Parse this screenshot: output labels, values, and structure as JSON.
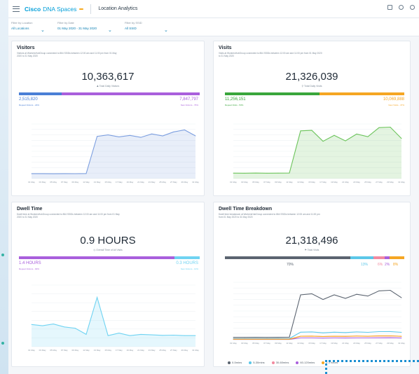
{
  "app": {
    "brand_primary": "Cisco",
    "brand_secondary": "DNA Spaces",
    "beta_badge": "",
    "page_title": "Location Analytics",
    "accent": "#049fd9"
  },
  "filters": [
    {
      "label": "Filter by Location",
      "value": "All Locations"
    },
    {
      "label": "Filter by Date",
      "value": "01 May 2020 - 31 May 2020"
    },
    {
      "label": "Filter by SSID",
      "value": "All SSID"
    }
  ],
  "visitors": {
    "title": "Visitors",
    "description": "Visitors at WorkersHubGroup connected to 864 SSIDs between 12:00 am and 11:00 pm from 01 May 2020 to 31 May 2020",
    "total": "10,363,617",
    "total_label": "Total Daily Visitors",
    "left_value": "2,515,820",
    "left_label": "Repeat Visitors - 24%",
    "right_value": "7,847,797",
    "right_label": "New Visitors - 76%",
    "left_color": "#4a7fd6",
    "right_color": "#a95fdc"
  },
  "visits": {
    "title": "Visits",
    "description": "Visits at WorkersHubGroup connected to 864 SSIDs between 12:00 am and 11:00 pm from 01 May 2020 to 31 May 2020",
    "total": "21,326,039",
    "total_label": "Total Daily Visits",
    "left_value": "11,256,151",
    "left_label": "Repeat Visits - 53%",
    "right_value": "10,069,888",
    "right_label": "New Visits - 47%",
    "left_color": "#3aa63c",
    "right_color": "#f5a623"
  },
  "dwell": {
    "title": "Dwell Time",
    "description": "Dwell time at WorkersHubGroup connected to 864 SSIDs between 12:00 am and 11:00 pm from 01 May 2020 to 31 May 2020",
    "total": "0.9 HOURS",
    "total_label": "Overall Time of All Visits",
    "left_value": "1.4 HOURS",
    "left_label": "Repeat Visitors - 90%",
    "right_value": "0.3 HOURS",
    "right_label": "New Visitors - 10%",
    "left_color": "#a95fdc",
    "right_color": "#6fd3f2"
  },
  "breakdown": {
    "title": "Dwell Time Breakdown",
    "description": "Dwell time breakdown at WorkersHubGroup connected to 864 SSIDs between 12:00 am and 11:00 pm from 01 May 2020 to 31 May 2020",
    "total": "21,318,496",
    "total_label": "Total Visits",
    "segments": [
      {
        "pct": "70%",
        "value": 70,
        "color": "#5b6470"
      },
      {
        "pct": "13%",
        "value": 13,
        "color": "#5bc7e8"
      },
      {
        "pct": "6%",
        "value": 6,
        "color": "#f28aa0"
      },
      {
        "pct": "2%",
        "value": 3,
        "color": "#a95fdc"
      },
      {
        "pct": "8%",
        "value": 8,
        "color": "#f5a623"
      }
    ],
    "legend": [
      "0-5mins",
      "5-30mins",
      "30-60mins",
      "60-120mins",
      "> 2 hours"
    ]
  },
  "chart_data": [
    {
      "type": "area",
      "title": "",
      "xlabel": "",
      "ylabel": "",
      "ylim": [
        0,
        1100000
      ],
      "x": [
        "01 May",
        "03 May",
        "05 May",
        "07 May",
        "09 May",
        "11 May",
        "13 May",
        "15 May",
        "17 May",
        "19 May",
        "21 May",
        "23 May",
        "25 May",
        "27 May",
        "29 May",
        "31 May"
      ],
      "series": [
        {
          "values": [
            100000,
            100000,
            98000,
            100000,
            99000,
            101000,
            850000,
            880000,
            840000,
            870000,
            830000,
            900000,
            860000,
            940000,
            980000,
            860000
          ]
        }
      ],
      "yticks": [
        "",
        "",
        "",
        "",
        "",
        "",
        "",
        "",
        "",
        "",
        ""
      ],
      "color": "#7d9fe0"
    },
    {
      "type": "area",
      "title": "",
      "xlabel": "",
      "ylabel": "",
      "ylim": [
        0,
        1200000
      ],
      "x": [
        "01 May",
        "03 May",
        "05 May",
        "07 May",
        "09 May",
        "11 May",
        "13 May",
        "15 May",
        "17 May",
        "19 May",
        "21 May",
        "23 May",
        "25 May",
        "27 May",
        "29 May",
        "31 May"
      ],
      "series": [
        {
          "values": [
            120000,
            118000,
            121000,
            119000,
            120000,
            122000,
            1050000,
            1060000,
            820000,
            950000,
            830000,
            980000,
            920000,
            1120000,
            1130000,
            880000
          ]
        }
      ],
      "yticks": [
        "",
        "",
        "",
        "",
        "",
        "",
        "",
        "",
        "",
        "",
        ""
      ],
      "color": "#6cc45b"
    },
    {
      "type": "area",
      "title": "",
      "xlabel": "",
      "ylabel": "",
      "ylim": [
        0,
        2.5
      ],
      "x": [
        "01 May",
        "03 May",
        "05 May",
        "07 May",
        "09 May",
        "11 May",
        "13 May",
        "15 May",
        "17 May",
        "19 May",
        "21 May",
        "23 May",
        "25 May",
        "27 May",
        "29 May",
        "31 May"
      ],
      "series": [
        {
          "values": [
            0.9,
            0.85,
            0.92,
            0.8,
            0.75,
            0.5,
            2.0,
            0.45,
            0.55,
            0.45,
            0.5,
            0.48,
            0.46,
            0.47,
            0.45,
            0.45
          ]
        }
      ],
      "yticks": [
        "",
        "",
        "",
        "",
        "",
        "",
        "",
        ""
      ],
      "color": "#6fd3f2"
    },
    {
      "type": "line",
      "title": "",
      "xlabel": "",
      "ylabel": "",
      "ylim": [
        0,
        1000000
      ],
      "x": [
        "01 May",
        "03 May",
        "05 May",
        "07 May",
        "09 May",
        "11 May",
        "13 May",
        "15 May",
        "17 May",
        "19 May",
        "21 May",
        "23 May",
        "25 May",
        "27 May",
        "29 May",
        "31 May"
      ],
      "series": [
        {
          "name": "0-5mins",
          "color": "#5b6470",
          "values": [
            40000,
            40000,
            42000,
            40000,
            41000,
            43000,
            780000,
            800000,
            700000,
            780000,
            720000,
            790000,
            760000,
            850000,
            860000,
            730000
          ]
        },
        {
          "name": "5-30mins",
          "color": "#5bc7e8",
          "values": [
            20000,
            20000,
            21000,
            20000,
            21000,
            20000,
            130000,
            135000,
            120000,
            130000,
            125000,
            135000,
            128000,
            140000,
            142000,
            128000
          ]
        },
        {
          "name": "30-60mins",
          "color": "#f28aa0",
          "values": [
            10000,
            10000,
            10500,
            10000,
            10200,
            10100,
            60000,
            62000,
            55000,
            60000,
            57000,
            62000,
            59000,
            64000,
            65000,
            58000
          ]
        },
        {
          "name": "60-120mins",
          "color": "#a95fdc",
          "values": [
            5000,
            5000,
            5200,
            5000,
            5100,
            5000,
            30000,
            31000,
            28000,
            30000,
            29000,
            31000,
            30000,
            32000,
            33000,
            29000
          ]
        },
        {
          "name": "> 2 hours",
          "color": "#f5a623",
          "values": [
            8000,
            8000,
            8200,
            8000,
            8100,
            8000,
            60000,
            62000,
            56000,
            60000,
            58000,
            63000,
            60000,
            66000,
            67000,
            59000
          ]
        }
      ],
      "yticks": [
        "",
        "",
        "",
        "",
        "",
        "",
        "",
        "",
        "",
        "",
        ""
      ]
    }
  ]
}
